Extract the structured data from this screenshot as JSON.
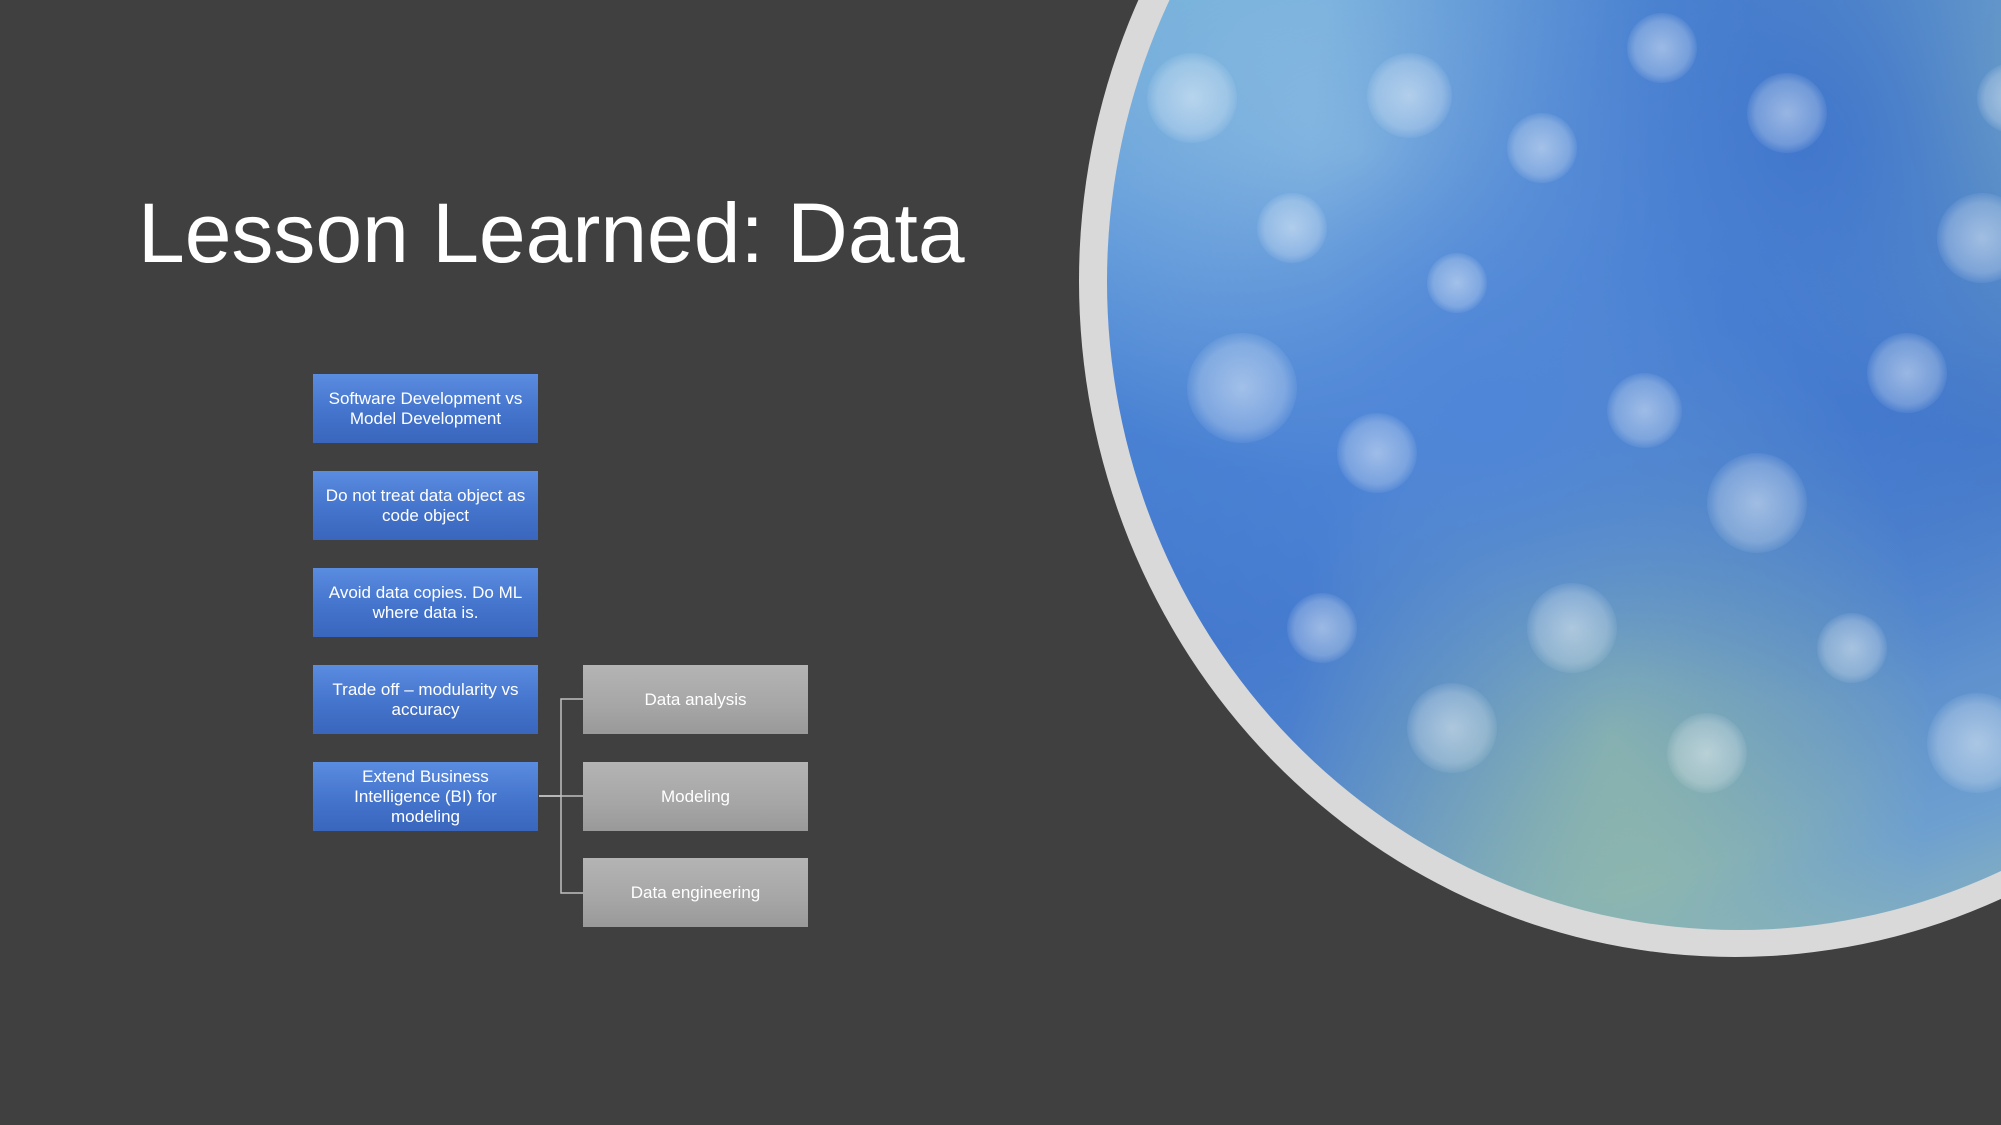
{
  "slide": {
    "title": "Lesson Learned: Data"
  },
  "diagram": {
    "left_column": [
      "Software Development vs Model Development",
      "Do not treat data object as code object",
      "Avoid data copies.  Do ML where data is.",
      "Trade off – modularity vs accuracy",
      "Extend Business Intelligence (BI) for modeling"
    ],
    "right_column": [
      "Data analysis",
      "Modeling",
      "Data engineering"
    ],
    "colors": {
      "background": "#404040",
      "left_box": "#4472c4",
      "right_box": "#a6a6a6",
      "connector": "#bfbfbf",
      "photo_ring": "#d9d9d9"
    }
  },
  "image": {
    "icon": "bokeh-photo"
  }
}
